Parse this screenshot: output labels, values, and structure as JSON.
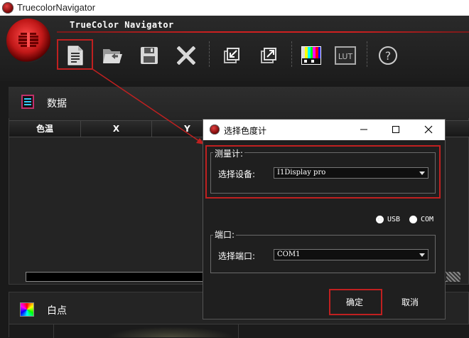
{
  "window": {
    "title": "TruecolorNavigator"
  },
  "app": {
    "title": "TrueColor Navigator"
  },
  "toolbar": {
    "buttons": [
      {
        "name": "new-document",
        "icon": "document-icon"
      },
      {
        "name": "open-folder",
        "icon": "folder-open-icon"
      },
      {
        "name": "save",
        "icon": "floppy-disk-icon"
      },
      {
        "name": "delete",
        "icon": "x-icon"
      },
      {
        "name": "import",
        "icon": "import-icon"
      },
      {
        "name": "export",
        "icon": "export-icon"
      },
      {
        "name": "test-pattern",
        "icon": "color-bars-icon"
      },
      {
        "name": "lut",
        "icon": "lut-icon",
        "label": "LUT"
      },
      {
        "name": "help",
        "icon": "question-icon",
        "label": "?"
      }
    ]
  },
  "data_panel": {
    "title": "数据",
    "columns": [
      "色温",
      "X",
      "Y"
    ]
  },
  "white_panel": {
    "title": "白点"
  },
  "dialog": {
    "title": "选择色度计",
    "meter_group": {
      "label": "测量计:",
      "device_label": "选择设备:",
      "device_value": "I1Display pro"
    },
    "connection": {
      "options": [
        {
          "label": "USB",
          "selected": true
        },
        {
          "label": "COM",
          "selected": false
        }
      ]
    },
    "port_group": {
      "label": "端口:",
      "port_label": "选择端口:",
      "port_value": "COM1"
    },
    "ok_label": "确定",
    "cancel_label": "取消"
  },
  "colors": {
    "highlight": "#c02020",
    "accent_line": "#d02020",
    "background": "#1a1a1a"
  }
}
